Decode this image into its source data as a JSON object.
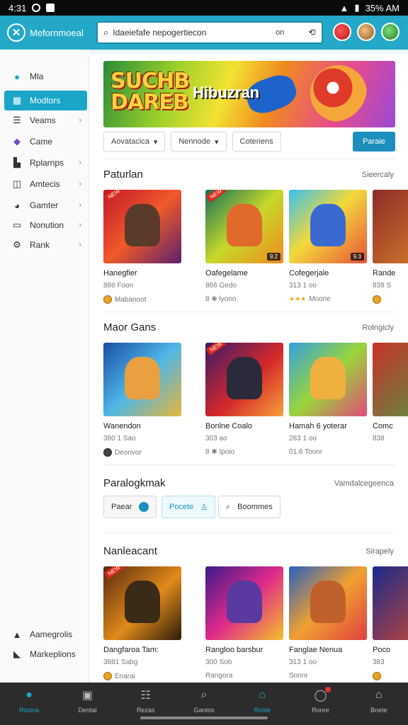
{
  "status": {
    "time": "4:31",
    "battery": "35% AM"
  },
  "header": {
    "brand": "Mefornmoeal",
    "search_value": "Idaeiefafe nepogertiecon",
    "search_scope": "on"
  },
  "sidebar": {
    "items": [
      {
        "label": "Mla",
        "icon": "location-icon"
      },
      {
        "label": "Modtors",
        "icon": "grid-icon",
        "active": true
      },
      {
        "label": "Veams",
        "icon": "list-icon"
      },
      {
        "label": "Came",
        "icon": "puzzle-icon"
      },
      {
        "label": "Rplarnps",
        "icon": "book-icon"
      },
      {
        "label": "Amtecis",
        "icon": "tag-icon"
      },
      {
        "label": "Gamter",
        "icon": "chat-icon"
      },
      {
        "label": "Nonution",
        "icon": "monitor-icon"
      },
      {
        "label": "Rank",
        "icon": "gear-icon"
      }
    ],
    "footer": [
      {
        "label": "Aamegrolis",
        "icon": "person-icon"
      },
      {
        "label": "Markeplions",
        "icon": "people-icon"
      }
    ]
  },
  "banner": {
    "title_line1": "SUCHB",
    "title_line2": "DAREB",
    "subtitle": "Hibuzran"
  },
  "filters": {
    "f1": "Aovatacica",
    "f2": "Nennode",
    "f3": "Coteriens",
    "primary": "Paraie"
  },
  "sections": {
    "s1": {
      "title": "Paturlan",
      "link": "Sieercaly"
    },
    "s2": {
      "title": "Maor Gans",
      "link": "Rolngicly"
    },
    "s3": {
      "title": "Paralogkmak",
      "link": "Vamdalcegeenca"
    },
    "s4": {
      "title": "Nanleacant",
      "link": "Sirapely"
    }
  },
  "row1": [
    {
      "name": "Hanegfier",
      "meta": "886 Foon",
      "foot": "Mabanoot"
    },
    {
      "name": "Oafegelame",
      "meta": "866 Gedo",
      "foot": "8 ❀ lyono"
    },
    {
      "name": "Cofegerjale",
      "meta": "313 1 oo",
      "foot": "Moone"
    },
    {
      "name": "Rande",
      "meta": "838 S",
      "foot": ""
    }
  ],
  "row2": [
    {
      "name": "Wanendon",
      "meta": "380 1 Sao",
      "foot": "Deonvor"
    },
    {
      "name": "Bonlne Coalo",
      "meta": "303 ao",
      "foot": "8 ✱ Ipoio"
    },
    {
      "name": "Hamah 6 yoterar",
      "meta": "283 1 oo",
      "foot": "01.6 Toonr"
    },
    {
      "name": "Comc",
      "meta": "838",
      "foot": ""
    }
  ],
  "pills": {
    "p1": "Paear",
    "p2": "Pocete",
    "p3": "Boommes"
  },
  "row3": [
    {
      "name": "Dangfaroa Tam:",
      "meta": "3881 Sabg",
      "foot": "Enarai"
    },
    {
      "name": "Rangloo barsbur",
      "meta": "300 Sob",
      "foot": "Rangora"
    },
    {
      "name": "Fanglae Nenua",
      "meta": "313 1 oo",
      "foot": "Sonnr"
    },
    {
      "name": "Poco",
      "meta": "383",
      "foot": ""
    }
  ],
  "bottomnav": [
    {
      "label": "Rizona",
      "icon": "blob-icon",
      "active": true
    },
    {
      "label": "Dental",
      "icon": "box-icon"
    },
    {
      "label": "Rezas",
      "icon": "menu-icon"
    },
    {
      "label": "Gantos",
      "icon": "search-icon"
    },
    {
      "label": "Ronie",
      "icon": "home-icon",
      "active": true
    },
    {
      "label": "Ronre",
      "icon": "notification-icon"
    },
    {
      "label": "Bnete",
      "icon": "shop-icon"
    }
  ]
}
